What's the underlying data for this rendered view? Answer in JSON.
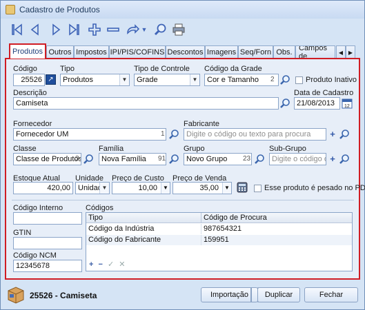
{
  "window": {
    "title": "Cadastro de Produtos"
  },
  "tabs": [
    "Produtos",
    "Outros",
    "Impostos",
    "IPI/PIS/COFINS",
    "Descontos",
    "Imagens",
    "Seq/Forn",
    "Obs.",
    "Campos de"
  ],
  "labels": {
    "codigo": "Código",
    "tipo": "Tipo",
    "tipo_controle": "Tipo de Controle",
    "codigo_grade": "Código da Grade",
    "produto_inativo": "Produto Inativo",
    "descricao": "Descrição",
    "data_cadastro": "Data de Cadastro",
    "fornecedor": "Fornecedor",
    "fabricante": "Fabricante",
    "classe": "Classe",
    "familia": "Família",
    "grupo": "Grupo",
    "sub_grupo": "Sub-Grupo",
    "estoque_atual": "Estoque Atual",
    "unidade": "Unidade",
    "preco_custo": "Preço de Custo",
    "preco_venda": "Preço de Venda",
    "pesado_pdv": "Esse produto é pesado no PDV",
    "codigo_interno": "Código Interno",
    "codigos": "Códigos",
    "gtin": "GTIN",
    "codigo_ncm": "Código NCM"
  },
  "fields": {
    "codigo": "25526",
    "tipo": "Produtos",
    "tipo_controle": "Grade",
    "codigo_grade": "Cor e Tamanho",
    "codigo_grade_num": "2",
    "descricao": "Camiseta",
    "data_cadastro": "21/08/2013",
    "fornecedor": "Fornecedor UM",
    "fornecedor_num": "1",
    "fabricante_placeholder": "Digite o código ou texto para procura",
    "classe": "Classe de Produtos",
    "classe_num": "3",
    "familia": "Nova Família",
    "familia_num": "91",
    "grupo": "Novo Grupo",
    "grupo_num": "23",
    "sub_grupo_placeholder": "Digite o código ou te",
    "estoque_atual": "420,00",
    "unidade": "Unidade",
    "preco_custo": "10,00",
    "preco_venda": "35,00",
    "codigo_interno": "",
    "gtin": "",
    "codigo_ncm": "12345678"
  },
  "codigos_grid": {
    "headers": [
      "Tipo",
      "Código de Procura"
    ],
    "rows": [
      [
        "Código da Indústria",
        "987654321"
      ],
      [
        "Código do Fabricante",
        "159951"
      ]
    ]
  },
  "footer": {
    "product_code": "25526",
    "separator": " - ",
    "product_name": "Camiseta",
    "btn_importacao": "Importação",
    "btn_duplicar": "Duplicar",
    "btn_fechar": "Fechar"
  },
  "colors": {
    "accent": "#d01c24",
    "toolbar_icon": "#3f64b7",
    "window_bg": "#d5e4f5"
  },
  "icons": [
    "first-icon",
    "prev-icon",
    "next-icon",
    "last-icon",
    "add-icon",
    "remove-icon",
    "redo-icon",
    "search-icon",
    "print-icon"
  ]
}
